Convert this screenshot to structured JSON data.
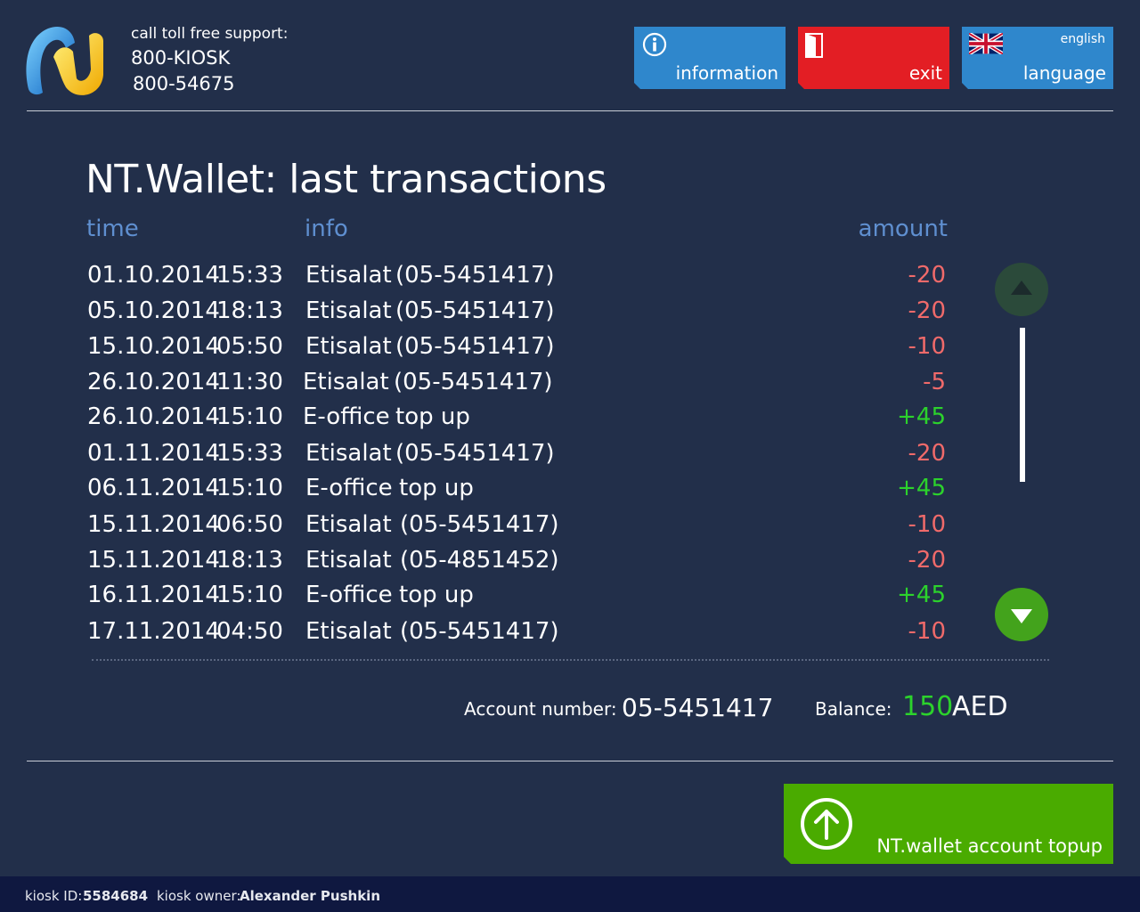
{
  "header": {
    "support_title": "call toll free support:",
    "support_phone_1": "800-KIOSK",
    "support_phone_2": "800-54675",
    "buttons": {
      "information": "information",
      "exit": "exit",
      "language": "language",
      "language_current": "english"
    }
  },
  "page": {
    "title": "NT.Wallet: last transactions"
  },
  "table": {
    "headers": {
      "time": "time",
      "info": "info",
      "amount": "amount"
    },
    "rows": [
      {
        "date": "01.10.2014",
        "time": "15:33",
        "op": "Etisalat",
        "detail": "(05-5451417)",
        "amount": "-20",
        "sign": "neg"
      },
      {
        "date": "05.10.2014",
        "time": "18:13",
        "op": "Etisalat",
        "detail": "(05-5451417)",
        "amount": "-20",
        "sign": "neg"
      },
      {
        "date": "15.10.2014",
        "time": "05:50",
        "op": "Etisalat",
        "detail": "(05-5451417)",
        "amount": "-10",
        "sign": "neg"
      },
      {
        "date": "26.10.2014",
        "time": "11:30",
        "op": "Etisalat",
        "detail": "(05-5451417)",
        "amount": "-5",
        "sign": "neg"
      },
      {
        "date": "26.10.2014",
        "time": "15:10",
        "op": "E-office",
        "detail": "top up",
        "amount": "+45",
        "sign": "pos"
      },
      {
        "date": "01.11.2014",
        "time": "15:33",
        "op": "Etisalat",
        "detail": "(05-5451417)",
        "amount": "-20",
        "sign": "neg"
      },
      {
        "date": "06.11.2014",
        "time": "15:10",
        "op": "E-office",
        "detail": "top up",
        "amount": "+45",
        "sign": "pos"
      },
      {
        "date": "15.11.2014",
        "time": "06:50",
        "op": "Etisalat",
        "detail": "(05-5451417)",
        "amount": "-10",
        "sign": "neg"
      },
      {
        "date": "15.11.2014",
        "time": "18:13",
        "op": "Etisalat",
        "detail": "(05-4851452)",
        "amount": "-20",
        "sign": "neg"
      },
      {
        "date": "16.11.2014",
        "time": "15:10",
        "op": "E-office",
        "detail": "top up",
        "amount": "+45",
        "sign": "pos"
      },
      {
        "date": "17.11.2014",
        "time": "04:50",
        "op": "Etisalat",
        "detail": "(05-5451417)",
        "amount": "-10",
        "sign": "neg"
      }
    ]
  },
  "account": {
    "number_label": "Account number:",
    "number_value": "05-5451417",
    "balance_label": "Balance:",
    "balance_value": "150",
    "currency": "AED"
  },
  "topup": {
    "label": "NT.wallet account topup"
  },
  "footer": {
    "kiosk_id_label": "kiosk ID:",
    "kiosk_id_value": "5584684",
    "kiosk_owner_label": "kiosk owner:",
    "kiosk_owner_value": "Alexander Pushkin"
  },
  "colors": {
    "background": "#222f4a",
    "info_button": "#2f87cc",
    "exit_button": "#e31e24",
    "topup_button": "#4aab00",
    "negative_amount": "#f06a6a",
    "positive_amount": "#2cd22c",
    "column_header": "#5f8fd0"
  },
  "icons": {
    "logo": "kiosk-logo",
    "information": "info-icon",
    "exit": "door-icon",
    "language": "uk-flag-icon",
    "scroll_up": "arrow-up-icon",
    "scroll_down": "arrow-down-icon",
    "topup": "circle-arrow-up-icon"
  }
}
